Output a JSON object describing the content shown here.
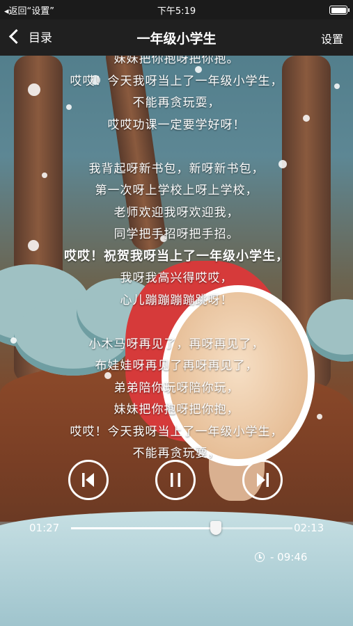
{
  "status_bar": {
    "back_label": "◂返回“设置”",
    "time": "下午5:19"
  },
  "nav": {
    "back_label": "目录",
    "title": "一年级小学生",
    "settings_label": "设置"
  },
  "lyrics": [
    {
      "text": "妹妹把你抱呀把你抱。",
      "active": false
    },
    {
      "text": "哎哎！今天我呀当上了一年级小学生，",
      "active": false
    },
    {
      "text": "不能再贪玩耍，",
      "active": false
    },
    {
      "text": "哎哎功课一定要学好呀！",
      "active": false
    },
    {
      "text": "",
      "active": false
    },
    {
      "text": "我背起呀新书包，新呀新书包，",
      "active": false
    },
    {
      "text": "第一次呀上学校上呀上学校，",
      "active": false
    },
    {
      "text": "老师欢迎我呀欢迎我，",
      "active": false
    },
    {
      "text": "同学把手招呀把手招。",
      "active": false
    },
    {
      "text": "哎哎！祝贺我呀当上了一年级小学生，",
      "active": true
    },
    {
      "text": "我呀我高兴得哎哎，",
      "active": false
    },
    {
      "text": "心儿蹦蹦蹦蹦跳呀！",
      "active": false
    },
    {
      "text": "",
      "active": false
    },
    {
      "text": "小木马呀再见了，再呀再见了，",
      "active": false
    },
    {
      "text": "布娃娃呀再见了再呀再见了，",
      "active": false
    },
    {
      "text": "弟弟陪你玩呀陪你玩，",
      "active": false
    },
    {
      "text": "妹妹把你抱呀把你抱，",
      "active": false
    },
    {
      "text": "哎哎！今天我呀当上了一年级小学生，",
      "active": false
    },
    {
      "text": "不能再贪玩耍，",
      "active": false
    }
  ],
  "player": {
    "elapsed": "01:27",
    "duration": "02:13",
    "progress": 0.654,
    "timer_label": "- 09:46",
    "icons": {
      "prev": "skip-previous-icon",
      "pause": "pause-icon",
      "next": "skip-next-icon",
      "timer": "clock-icon",
      "battery": "battery-icon",
      "back": "chevron-left-icon"
    }
  }
}
